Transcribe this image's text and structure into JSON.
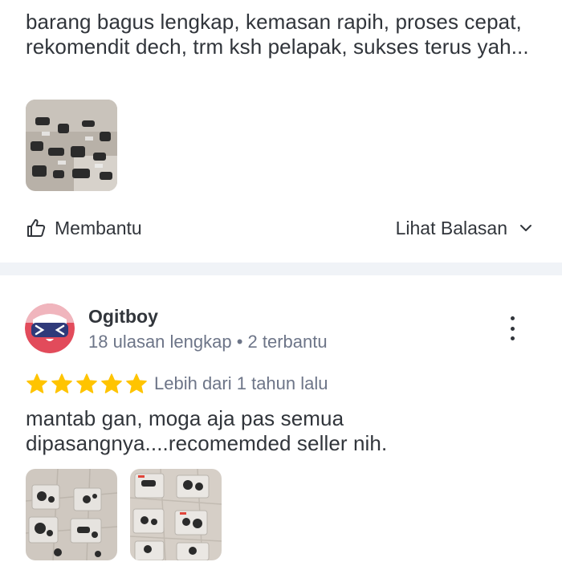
{
  "review_1": {
    "text": "barang bagus lengkap, kemasan rapih, proses cepat, rekomendit dech, trm ksh pelapak, sukses terus yah...",
    "helpful_label": "Membantu",
    "see_replies_label": "Lihat Balasan",
    "icons": {
      "helpful": "thumbs-up-icon",
      "replies": "chevron-down-icon"
    }
  },
  "review_2": {
    "reviewer_name": "Ogitboy",
    "reviewer_meta": "18 ulasan lengkap • 2 terbantu",
    "rating": 5,
    "time_ago": "Lebih dari 1 tahun lalu",
    "text": "mantab gan, moga aja pas semua dipasangnya....recomemded seller nih.",
    "icons": {
      "menu": "more-vertical-icon",
      "star": "star-icon"
    }
  },
  "colors": {
    "text": "#31353b",
    "meta": "#6d7588",
    "star": "#ffc400",
    "divider": "#f0f3f7",
    "avatar_bg": "#e24b5b"
  }
}
